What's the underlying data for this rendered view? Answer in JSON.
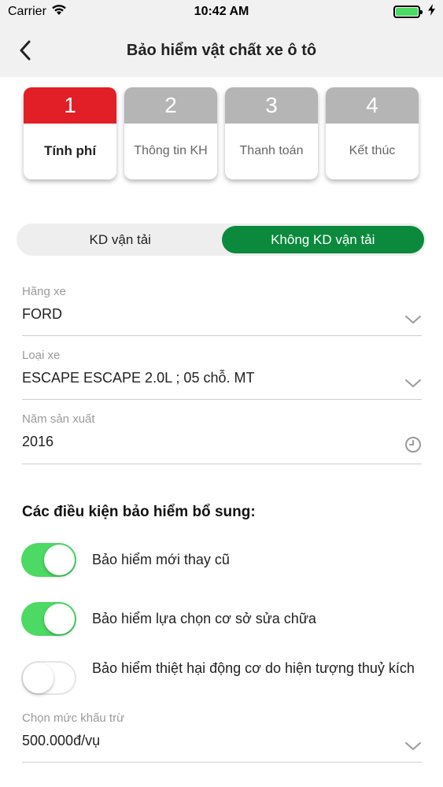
{
  "status_bar": {
    "carrier": "Carrier",
    "time": "10:42 AM",
    "battery_color": "#4cd964"
  },
  "nav": {
    "title": "Bảo hiểm vật chất xe ô tô",
    "back_icon": "chevron-left-icon"
  },
  "steps": [
    {
      "number": "1",
      "label": "Tính phí",
      "active": true
    },
    {
      "number": "2",
      "label": "Thông tin KH",
      "active": false
    },
    {
      "number": "3",
      "label": "Thanh toán",
      "active": false
    },
    {
      "number": "4",
      "label": "Kết thúc",
      "active": false
    }
  ],
  "segment": {
    "options": [
      "KD vận tải",
      "Không KD vận tải"
    ],
    "selected": "Không KD vận tải"
  },
  "fields": {
    "brand": {
      "label": "Hãng xe",
      "value": "FORD",
      "icon": "chevron-down-icon"
    },
    "model": {
      "label": "Loại xe",
      "value": "ESCAPE ESCAPE 2.0L ; 05 chỗ. MT",
      "icon": "chevron-down-icon"
    },
    "year": {
      "label": "Năm sản xuất",
      "value": "2016",
      "icon": "clock-icon"
    },
    "deductible": {
      "label": "Chọn mức khấu trừ",
      "value": "500.000đ/vụ",
      "icon": "chevron-down-icon"
    }
  },
  "extra": {
    "title": "Các điều kiện bảo hiểm bổ sung:",
    "options": [
      {
        "label": "Bảo hiểm mới thay cũ",
        "on": true
      },
      {
        "label": "Bảo hiểm lựa chọn cơ sở sửa chữa",
        "on": true
      },
      {
        "label": "Bảo hiểm thiệt hại động cơ do hiện tượng thuỷ kích",
        "on": false
      }
    ]
  },
  "colors": {
    "accent_red": "#e21f26",
    "accent_green": "#0b8a3e",
    "toggle_green": "#4cd964"
  }
}
